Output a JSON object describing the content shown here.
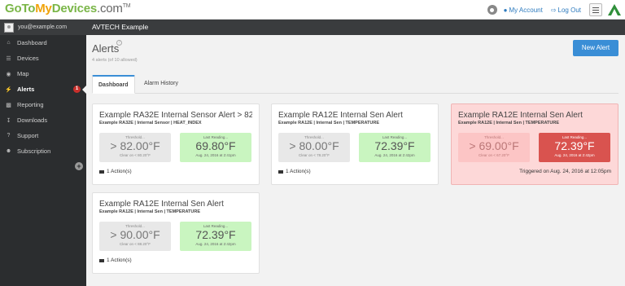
{
  "topbar": {
    "logo": {
      "go": "Go",
      "to": "To",
      "my": "My",
      "devices": "Devices",
      "dotcom": ".com",
      "tm": "TM"
    },
    "my_account": "My Account",
    "log_out": "Log Out"
  },
  "sidebar": {
    "user": "you@example.com",
    "items": [
      {
        "label": "Dashboard",
        "icon": "home-icon"
      },
      {
        "label": "Devices",
        "icon": "list-icon"
      },
      {
        "label": "Map",
        "icon": "globe-icon"
      },
      {
        "label": "Alerts",
        "icon": "bolt-icon",
        "badge": "1"
      },
      {
        "label": "Reporting",
        "icon": "bar-chart-icon"
      },
      {
        "label": "Downloads",
        "icon": "download-icon"
      },
      {
        "label": "Support",
        "icon": "question-icon"
      },
      {
        "label": "Subscription",
        "icon": "users-icon"
      }
    ]
  },
  "header": {
    "title": "AVTECH Example"
  },
  "page": {
    "title": "Alerts",
    "count_text": "4 alerts (of 10 allowed)",
    "new_alert": "New Alert",
    "tabs": [
      "Dashboard",
      "Alarm History"
    ]
  },
  "cards": [
    {
      "title": "Example RA32E Internal Sensor Alert > 82",
      "sub": "Example RA32E | Internal Sensor | HEAT_INDEX",
      "threshold_label": "Threshold...",
      "threshold": "> 82.00°F",
      "clear": "Clear on < 80.20°F",
      "reading_label": "Last Reading...",
      "reading": "69.80°F",
      "reading_time": "Aug. 24, 2016 at 2:41pm",
      "actions": "1 Action(s)"
    },
    {
      "title": "Example RA12E Internal Sen Alert",
      "sub": "Example RA12E | Internal Sen | TEMPERATURE",
      "threshold_label": "Threshold...",
      "threshold": "> 80.00°F",
      "clear": "Clear on < 78.20°F",
      "reading_label": "Last Reading...",
      "reading": "72.39°F",
      "reading_time": "Aug. 24, 2016 at 2:42pm",
      "actions": "1 Action(s)"
    },
    {
      "title": "Example RA12E Internal Sen Alert",
      "sub": "Example RA12E | Internal Sen | TEMPERATURE",
      "threshold_label": "Threshold...",
      "threshold": "> 69.00°F",
      "clear": "Clear on < 67.20°F",
      "reading_label": "Last Reading...",
      "reading": "72.39°F",
      "reading_time": "Aug. 24, 2016 at 2:42pm",
      "triggered": "Triggered on Aug. 24, 2016 at 12:05pm",
      "status_color": "#d9534f"
    },
    {
      "title": "Example RA12E Internal Sen Alert",
      "sub": "Example RA12E | Internal Sen | TEMPERATURE",
      "threshold_label": "Threshold...",
      "threshold": "> 90.00°F",
      "clear": "Clear on < 88.20°F",
      "reading_label": "Last Reading...",
      "reading": "72.39°F",
      "reading_time": "Aug. 24, 2016 at 2:42pm",
      "actions": "1 Action(s)"
    }
  ],
  "colors": {
    "accent": "#3a8ed6",
    "ok": "#c9f5c0",
    "danger": "#d9534f",
    "sidebar": "#2b2d2f"
  }
}
